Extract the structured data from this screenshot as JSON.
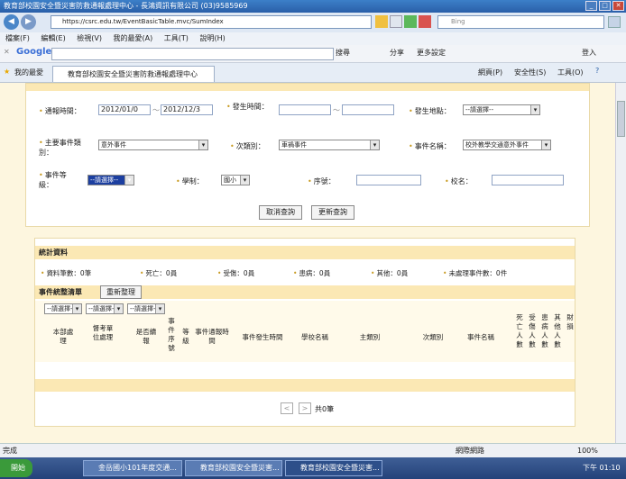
{
  "window": {
    "title": "教育部校園安全暨災害防救通報處理中心 - 長鴻資訊有限公司 (03)9585969",
    "buttons": [
      "_",
      "□",
      "✕"
    ]
  },
  "address": {
    "url": "https://csrc.edu.tw/EventBasicTable.mvc/SumIndex",
    "search_placeholder": "Bing"
  },
  "menu": [
    "檔案(F)",
    "編輯(E)",
    "檢視(V)",
    "我的最愛(A)",
    "工具(T)",
    "說明(H)"
  ],
  "google_bar": {
    "logo": "Google",
    "search_btn": "搜尋",
    "share": "分享",
    "more": "更多設定",
    "login": "登入"
  },
  "fav_bar": {
    "favorites": "我的最愛",
    "tab_title": "教育部校園安全暨災害防救通報處理中心",
    "tools": [
      "網頁(P)",
      "安全性(S)",
      "工具(O)"
    ]
  },
  "query_form": {
    "report_time_label": "通報時間：",
    "report_time_from": "2012/01/0",
    "report_time_to": "2012/12/3",
    "occur_time_label": "發生時間：",
    "occur_place_label": "發生地點：",
    "occur_place_value": "--請選擇--",
    "main_type_label": "主要事件類別：",
    "main_type_value": "意外事件",
    "sub_type_label": "次類別：",
    "sub_type_value": "車禍事件",
    "event_name_label": "事件名稱：",
    "event_name_value": "校外教學交通意外事件",
    "event_level_label": "事件等級：",
    "event_level_value": "--請選擇--",
    "school_system_label": "學制：",
    "school_system_value": "國小",
    "serial_label": "序號：",
    "school_name_label": "校名：",
    "cancel_btn": "取消查詢",
    "refresh_btn": "更新查詢"
  },
  "stats": {
    "section_title": "統計資料",
    "items": [
      "資料筆數：0筆",
      "死亡：0員",
      "受傷：0員",
      "患病：0員",
      "其他：0員",
      "未處理事件數：0件"
    ]
  },
  "event_list": {
    "section_title": "事件統整清單",
    "reorg_btn": "重新整理",
    "filters": [
      "--請選擇--",
      "--請選擇--",
      "--請選擇--"
    ],
    "columns": [
      "本部處理",
      "督考單位處理",
      "是否續報",
      "事件序號",
      "等級",
      "事件通報時間",
      "事件發生時間",
      "學校名稱",
      "主類別",
      "次類別",
      "事件名稱",
      "死亡人數",
      "受傷人數",
      "患病人數",
      "其他人數",
      "財損"
    ],
    "pager_text": "共0筆",
    "prev": "<",
    "next": ">"
  },
  "status": {
    "left": "完成",
    "zone": "網際網路",
    "zoom": "100%"
  },
  "taskbar": {
    "start": "開始",
    "tasks": [
      "金岳國小101年度交通...",
      "教育部校園安全暨災害...",
      "教育部校園安全暨災害..."
    ],
    "clock": "下午 01:10"
  },
  "colors": {
    "accent": "#2a5fa8",
    "section_bg": "#fbe8b4",
    "page_bg": "#fdf6df"
  }
}
